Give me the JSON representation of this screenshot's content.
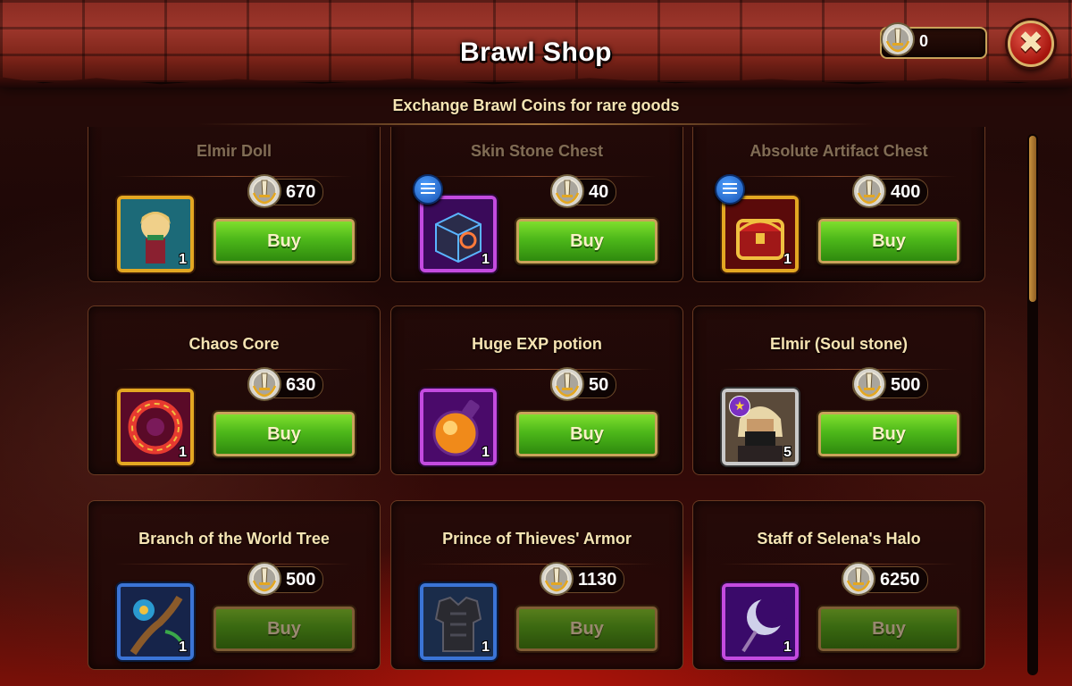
{
  "header": {
    "title": "Brawl Shop",
    "subtitle": "Exchange Brawl Coins for rare goods",
    "coin_balance": "0",
    "close_icon": "close-icon"
  },
  "shop": {
    "buy_label": "Buy",
    "items": [
      {
        "name": "Elmir Doll",
        "price": "670",
        "quantity": "1",
        "frame": "gold",
        "icon": "elmir-doll-icon"
      },
      {
        "name": "Skin Stone Chest",
        "price": "40",
        "quantity": "1",
        "frame": "purple",
        "icon": "skin-stone-chest-icon",
        "has_info": true
      },
      {
        "name": "Absolute Artifact Chest",
        "price": "400",
        "quantity": "1",
        "frame": "gold",
        "icon": "artifact-chest-icon",
        "has_info": true
      },
      {
        "name": "Chaos Core",
        "price": "630",
        "quantity": "1",
        "frame": "gold",
        "icon": "chaos-core-icon"
      },
      {
        "name": "Huge EXP potion",
        "price": "50",
        "quantity": "1",
        "frame": "purple",
        "icon": "exp-potion-icon"
      },
      {
        "name": "Elmir (Soul stone)",
        "price": "500",
        "quantity": "5",
        "frame": "silver",
        "icon": "elmir-soul-stone-icon"
      },
      {
        "name": "Branch of the World Tree",
        "price": "500",
        "quantity": "1",
        "frame": "blue",
        "icon": "world-tree-branch-icon"
      },
      {
        "name": "Prince of Thieves' Armor",
        "price": "1130",
        "quantity": "1",
        "frame": "blue",
        "icon": "thieves-armor-icon"
      },
      {
        "name": "Staff of Selena's Halo",
        "price": "6250",
        "quantity": "1",
        "frame": "purple",
        "icon": "selena-staff-icon"
      }
    ]
  },
  "colors": {
    "buy_button": "#4db81a",
    "gold_frame": "#e3a722",
    "purple_frame": "#c34be0",
    "blue_frame": "#3b74d6",
    "accent_text": "#f6e4b3"
  }
}
